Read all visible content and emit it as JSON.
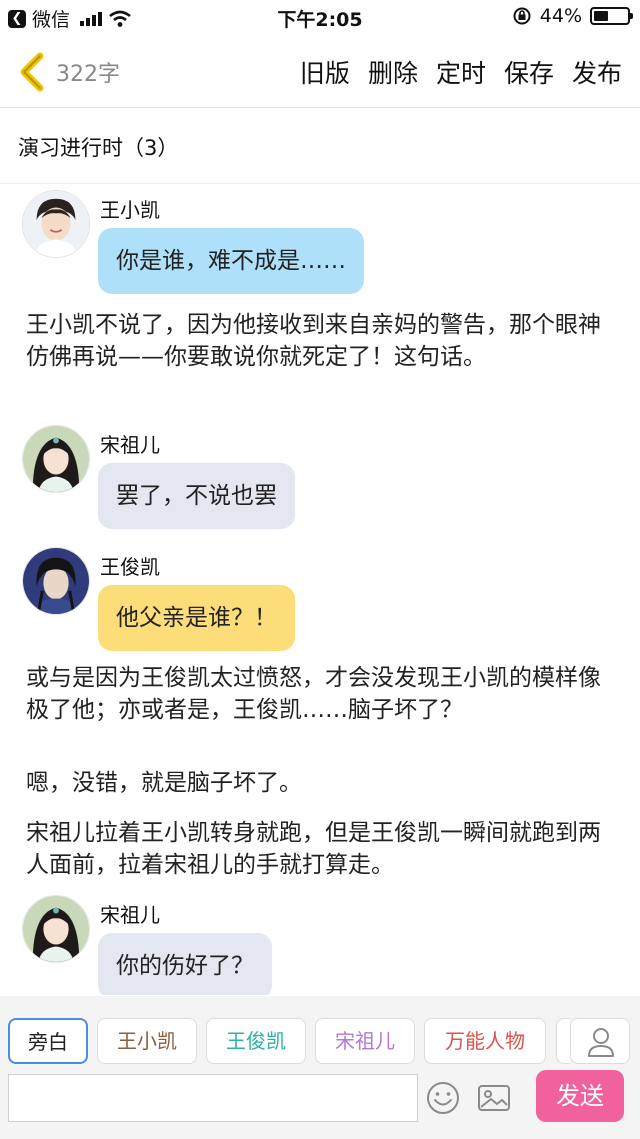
{
  "status_bar": {
    "app_back_label": "微信",
    "time": "下午2:05",
    "battery_percent": "44%",
    "battery_level": 0.44
  },
  "nav": {
    "word_count": "322字",
    "actions": [
      "旧版",
      "删除",
      "定时",
      "保存",
      "发布"
    ]
  },
  "chapter": {
    "title": "演习进行时（3）"
  },
  "messages": [
    {
      "speaker": "王小凯",
      "text": "你是谁，难不成是……",
      "bubble_color": "#aee0f9"
    },
    {
      "speaker": "宋祖儿",
      "text": "罢了，不说也罢",
      "bubble_color": "#e3e7ef"
    },
    {
      "speaker": "王俊凯",
      "text": "他父亲是谁？！",
      "bubble_color": "#fddd79"
    },
    {
      "speaker": "宋祖儿",
      "text": "你的伤好了？",
      "bubble_color": "#e3e7ef"
    }
  ],
  "narrations": [
    "王小凯不说了，因为他接收到来自亲妈的警告，那个眼神仿佛再说——你要敢说你就死定了！这句话。",
    "或与是因为王俊凯太过愤怒，才会没发现王小凯的模样像极了他；亦或者是，王俊凯……脑子坏了？",
    "嗯，没错，就是脑子坏了。",
    "宋祖儿拉着王小凯转身就跑，但是王俊凯一瞬间就跑到两人面前，拉着宋祖儿的手就打算走。"
  ],
  "roles": [
    {
      "label": "旁白",
      "color": "#222222",
      "selected": true
    },
    {
      "label": "王小凯",
      "color": "#8b5e3c",
      "selected": false
    },
    {
      "label": "王俊凯",
      "color": "#2bb3a3",
      "selected": false
    },
    {
      "label": "宋祖儿",
      "color": "#b07ad6",
      "selected": false
    },
    {
      "label": "万能人物",
      "color": "#d9534f",
      "selected": false
    }
  ],
  "input": {
    "value": "",
    "placeholder": ""
  },
  "send_label": "发送",
  "icons": {
    "back": "chevron-left-icon",
    "emoji": "emoji-icon",
    "image": "image-icon",
    "add_role": "person-icon"
  },
  "colors": {
    "accent_back": "#f2c400",
    "send": "#f1619b",
    "selected_role_border": "#4d8ed8"
  }
}
